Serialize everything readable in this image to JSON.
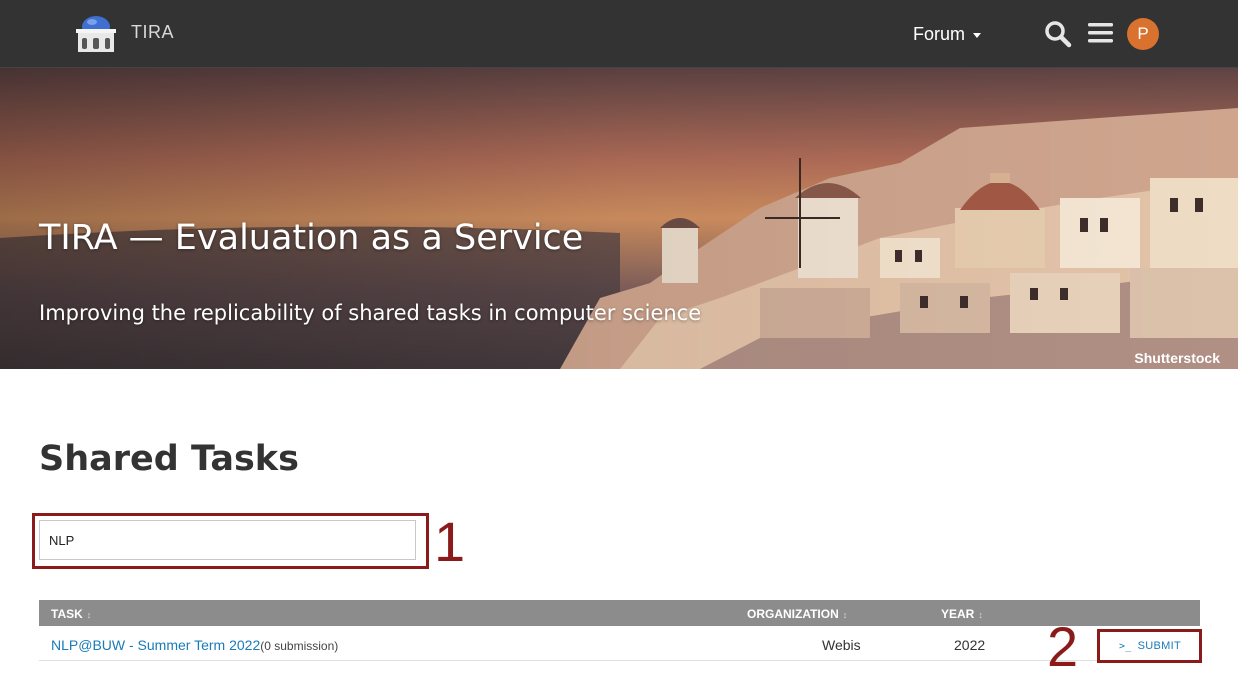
{
  "nav": {
    "brand": "TIRA",
    "forum_label": "Forum",
    "avatar_initial": "P",
    "icons": [
      "tira-logo-icon",
      "search-icon",
      "hamburger-menu-icon",
      "caret-down-icon"
    ]
  },
  "hero": {
    "title": "TIRA — Evaluation as a Service",
    "subtitle": "Improving the replicability of shared tasks in computer science",
    "credit": "Shutterstock"
  },
  "main": {
    "section_title": "Shared Tasks",
    "filter_value": "NLP",
    "annotations": [
      "1",
      "2"
    ],
    "table": {
      "columns": [
        "TASK",
        "ORGANIZATION",
        "YEAR"
      ],
      "sort_icon": "↕",
      "rows": [
        {
          "task": "NLP@BUW - Summer Term 2022",
          "submissions": "(0 submission)",
          "organization": "Webis",
          "year": "2022",
          "action": "SUBMIT",
          "action_icon": ">_"
        }
      ]
    }
  },
  "colors": {
    "nav_bg": "#333333",
    "accent_link": "#1a7bb9",
    "avatar": "#d9722e",
    "annotation": "#8b1a1a",
    "table_header": "#8c8c8c"
  }
}
